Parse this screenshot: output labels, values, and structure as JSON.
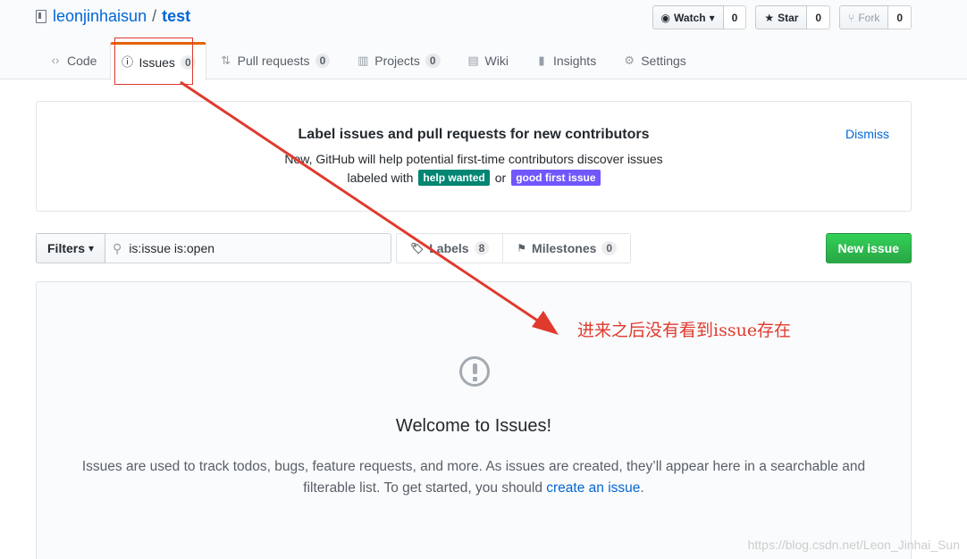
{
  "repo": {
    "owner": "leonjinhaisun",
    "separator": "/",
    "name": "test"
  },
  "actions": [
    {
      "label": "Watch",
      "count": "0",
      "icon": "eye-icon"
    },
    {
      "label": "Star",
      "count": "0",
      "icon": "star-icon"
    },
    {
      "label": "Fork",
      "count": "0",
      "icon": "fork-icon"
    }
  ],
  "nav": {
    "tabs": [
      {
        "label": "Code",
        "icon": "code-icon"
      },
      {
        "label": "Issues",
        "count": "0",
        "icon": "issue-opened-icon",
        "selected": true
      },
      {
        "label": "Pull requests",
        "count": "0",
        "icon": "git-pull-request-icon"
      },
      {
        "label": "Projects",
        "count": "0",
        "icon": "project-icon"
      },
      {
        "label": "Wiki",
        "icon": "book-icon"
      },
      {
        "label": "Insights",
        "icon": "graph-icon"
      },
      {
        "label": "Settings",
        "icon": "gear-icon"
      }
    ]
  },
  "banner": {
    "title": "Label issues and pull requests for new contributors",
    "line1": "Now, GitHub will help potential first-time contributors discover issues",
    "line2_prefix": "labeled with",
    "label1": {
      "text": "help wanted",
      "color": "#008672"
    },
    "or_text": "or",
    "label2": {
      "text": "good first issue",
      "color": "#7057ff"
    },
    "dismiss": "Dismiss"
  },
  "filters": {
    "button": "Filters",
    "search_value": "is:issue is:open",
    "labels": {
      "label": "Labels",
      "count": "8"
    },
    "milestones": {
      "label": "Milestones",
      "count": "0"
    },
    "new_issue": "New issue"
  },
  "blankslate": {
    "title": "Welcome to Issues!",
    "text": "Issues are used to track todos, bugs, feature requests, and more. As issues are created, they’ll appear here in a searchable and filterable list. To get started, you should",
    "link": "create an issue",
    "suffix": "."
  },
  "annotation": {
    "text": "进来之后没有看到issue存在",
    "color": "#e03a2e"
  },
  "watermark": "https://blog.csdn.net/Leon_Jinhai_Sun"
}
